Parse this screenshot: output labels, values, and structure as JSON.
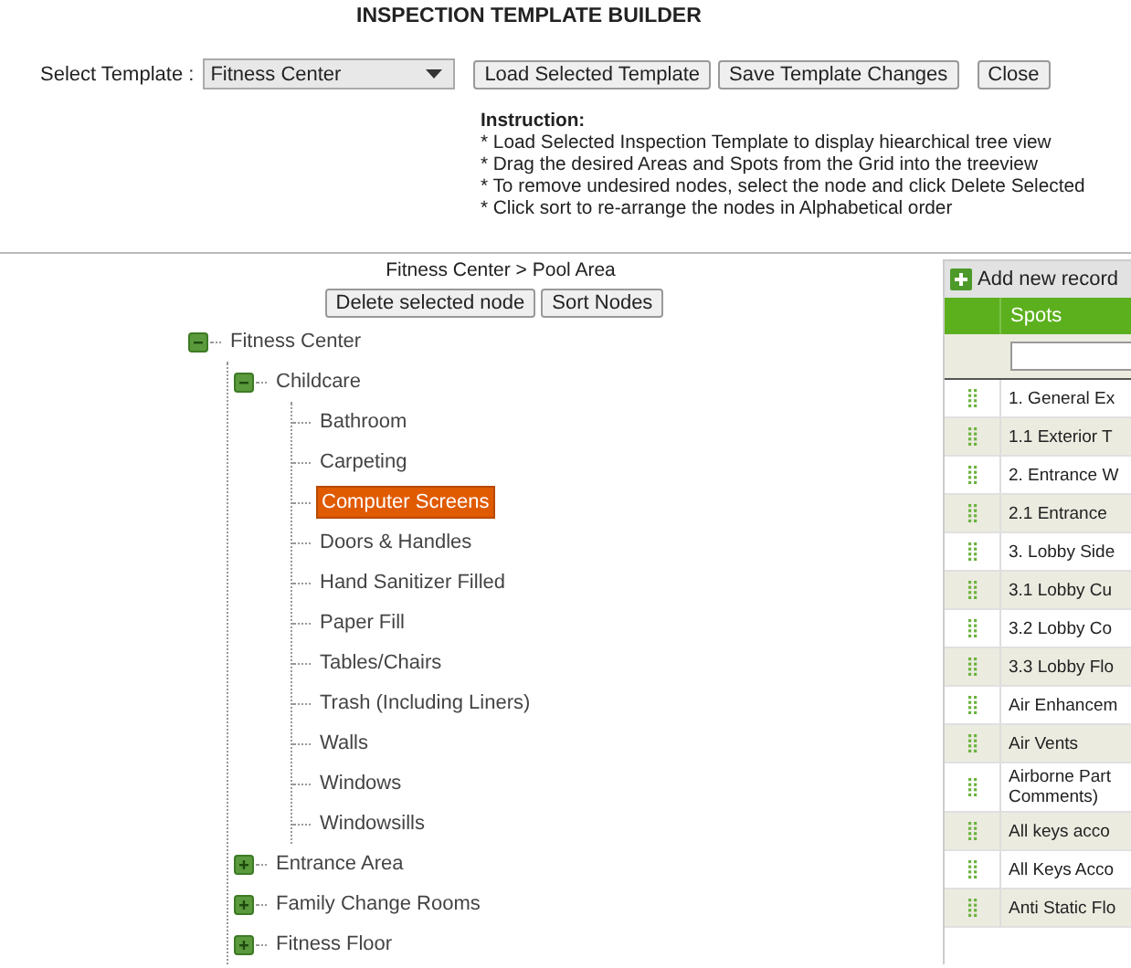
{
  "title": "INSPECTION TEMPLATE BUILDER",
  "template_select": {
    "label": "Select Template :",
    "value": "Fitness Center"
  },
  "buttons": [
    "Load Selected Template",
    "Save Template Changes",
    "Close"
  ],
  "instructions": {
    "heading": "Instruction:",
    "lines": [
      "* Load Selected Inspection Template to display hiearchical tree view",
      "* Drag the desired Areas and Spots from the Grid into the treeview",
      "* To remove undesired nodes, select the node and click Delete Selected",
      "* Click sort to re-arrange the nodes in Alphabetical order"
    ]
  },
  "breadcrumb": "Fitness Center > Pool Area",
  "tree_buttons": [
    "Delete selected node",
    "Sort Nodes"
  ],
  "tree": [
    {
      "label": "Fitness Center",
      "expanded": true,
      "selected": false,
      "children": [
        {
          "label": "Childcare",
          "expanded": true,
          "selected": false,
          "children": [
            {
              "label": "Bathroom",
              "selected": false
            },
            {
              "label": "Carpeting",
              "selected": false
            },
            {
              "label": "Computer Screens",
              "selected": true
            },
            {
              "label": "Doors & Handles",
              "selected": false
            },
            {
              "label": "Hand Sanitizer Filled",
              "selected": false
            },
            {
              "label": "Paper Fill",
              "selected": false
            },
            {
              "label": "Tables/Chairs",
              "selected": false
            },
            {
              "label": "Trash (Including Liners)",
              "selected": false
            },
            {
              "label": "Walls",
              "selected": false
            },
            {
              "label": "Windows",
              "selected": false
            },
            {
              "label": "Windowsills",
              "selected": false
            }
          ]
        },
        {
          "label": "Entrance Area",
          "expanded": false,
          "selected": false
        },
        {
          "label": "Family Change Rooms",
          "expanded": false,
          "selected": false
        },
        {
          "label": "Fitness Floor",
          "expanded": false,
          "selected": false
        }
      ]
    }
  ],
  "grid": {
    "toolbar": "Add new record",
    "columns": [
      "Spots"
    ],
    "rows": [
      "1. General Ex",
      "1.1 Exterior T",
      "2. Entrance W",
      "2.1 Entrance",
      "3. Lobby Side",
      "3.1 Lobby Cu",
      "3.2 Lobby Co",
      "3.3 Lobby Flo",
      "Air Enhancem",
      "Air Vents",
      "Airborne Part Comments)",
      "All keys acco",
      "All Keys Acco",
      "Anti Static Flo"
    ]
  }
}
